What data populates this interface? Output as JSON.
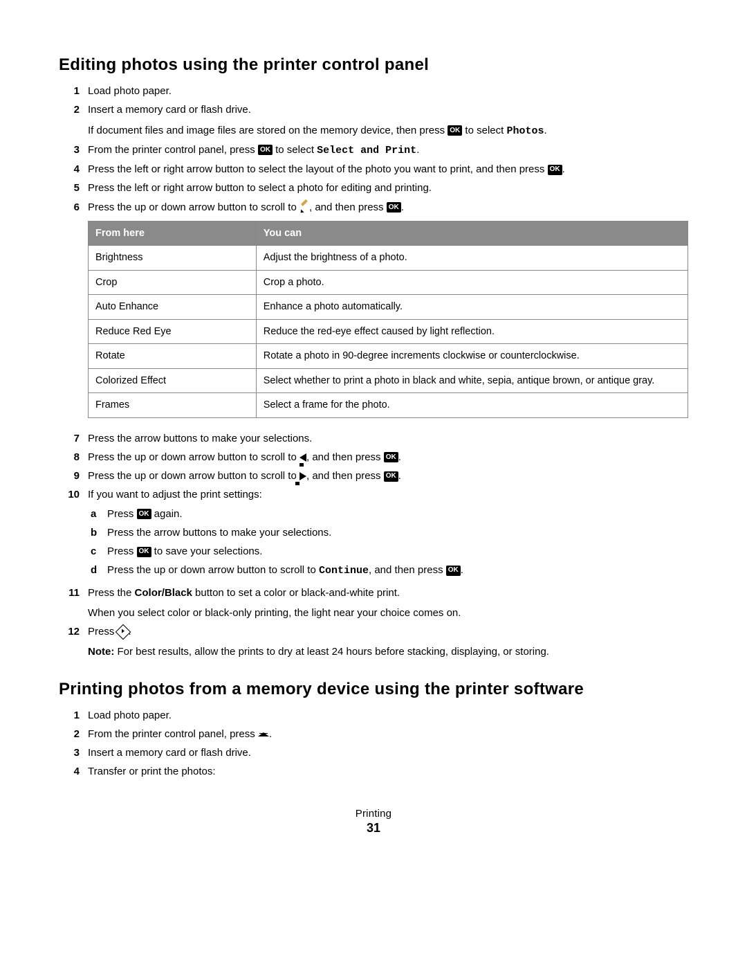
{
  "heading1": "Editing photos using the printer control panel",
  "step1": "Load photo paper.",
  "step2a": "Insert a memory card or flash drive.",
  "step2b_pre": "If document files and image files are stored on the memory device, then press ",
  "step2b_mid": " to select ",
  "step2b_mono": "Photos",
  "step2b_end": ".",
  "step3_pre": "From the printer control panel, press ",
  "step3_mid": " to select ",
  "step3_mono": "Select and Print",
  "step3_end": ".",
  "step4_pre": "Press the left or right arrow button to select the layout of the photo you want to print, and then press ",
  "step4_end": ".",
  "step5": "Press the left or right arrow button to select a photo for editing and printing.",
  "step6_pre": "Press the up or down arrow button to scroll to ",
  "step6_mid": ", and then press ",
  "step6_end": ".",
  "table": {
    "h1": "From here",
    "h2": "You can",
    "rows": [
      [
        "Brightness",
        "Adjust the brightness of a photo."
      ],
      [
        "Crop",
        "Crop a photo."
      ],
      [
        "Auto Enhance",
        "Enhance a photo automatically."
      ],
      [
        "Reduce Red Eye",
        "Reduce the red-eye effect caused by light reflection."
      ],
      [
        "Rotate",
        "Rotate a photo in 90-degree increments clockwise or counterclockwise."
      ],
      [
        "Colorized Effect",
        "Select whether to print a photo in black and white, sepia, antique brown, or antique gray."
      ],
      [
        "Frames",
        "Select a frame for the photo."
      ]
    ]
  },
  "step7": "Press the arrow buttons to make your selections.",
  "step8_pre": "Press the up or down arrow button to scroll to ",
  "step8_mid": ", and then press ",
  "step8_end": ".",
  "step9_pre": "Press the up or down arrow button to scroll to ",
  "step9_mid": ", and then press ",
  "step9_end": ".",
  "step10": "If you want to adjust the print settings:",
  "step10a_pre": "Press ",
  "step10a_post": " again.",
  "step10b": "Press the arrow buttons to make your selections.",
  "step10c_pre": "Press ",
  "step10c_post": " to save your selections.",
  "step10d_pre": "Press the up or down arrow button to scroll to ",
  "step10d_mono": "Continue",
  "step10d_mid": ", and then press ",
  "step10d_end": ".",
  "step11_pre": "Press the ",
  "step11_bold": "Color/Black",
  "step11_post": " button to set a color or black-and-white print.",
  "step11b": "When you select color or black-only printing, the light near your choice comes on.",
  "step12_pre": "Press ",
  "step12_end": ".",
  "note_label": "Note: ",
  "note_text": "For best results, allow the prints to dry at least 24 hours before stacking, displaying, or storing.",
  "heading2": "Printing photos from a memory device using the printer software",
  "b_step1": "Load photo paper.",
  "b_step2_pre": "From the printer control panel, press ",
  "b_step2_end": ".",
  "b_step3": "Insert a memory card or flash drive.",
  "b_step4": "Transfer or print the photos:",
  "ok": "OK",
  "footer_section": "Printing",
  "footer_page": "31"
}
